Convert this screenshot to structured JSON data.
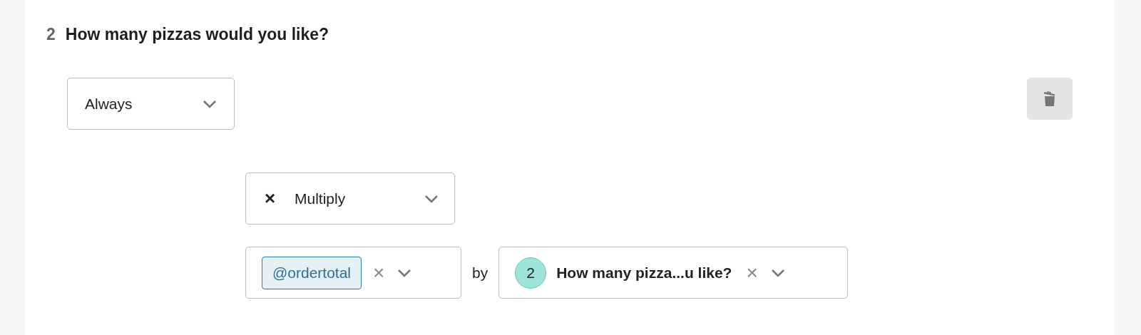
{
  "question": {
    "number": "2",
    "title": "How many pizzas would you like?"
  },
  "condition": {
    "value": "Always"
  },
  "operation": {
    "symbol": "×",
    "value": "Multiply"
  },
  "operand_left": {
    "tag": "@ordertotal",
    "clear": "×"
  },
  "connector": "by",
  "operand_right": {
    "badge": "2",
    "value": "How many pizza...u like?",
    "clear": "×"
  }
}
